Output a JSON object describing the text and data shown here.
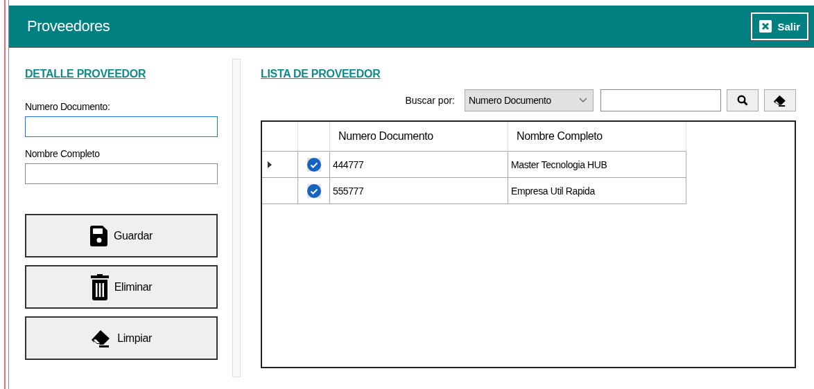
{
  "window": {
    "title": "Proveedores",
    "close_button": "Salir"
  },
  "detail": {
    "heading": "DETALLE PROVEEDOR",
    "fields": [
      {
        "label": "Numero Documento:",
        "focused": true
      },
      {
        "label": "Nombre Completo",
        "focused": false
      }
    ],
    "buttons": [
      {
        "kind": "save",
        "label": "Guardar"
      },
      {
        "kind": "delete",
        "label": "Eliminar"
      },
      {
        "kind": "clear",
        "label": "Limpiar"
      }
    ]
  },
  "list": {
    "heading": "LISTA DE PROVEEDOR",
    "search_label": "Buscar por:",
    "search_by": "Numero Documento",
    "table": {
      "columns": [
        "Numero Documento",
        "Nombre Completo"
      ],
      "rows": [
        {
          "selected": true,
          "checked": true,
          "cells": [
            "444777",
            "Master Tecnologia HUB"
          ]
        },
        {
          "selected": false,
          "checked": true,
          "cells": [
            "555777",
            "Empresa Util Rapida"
          ]
        }
      ]
    }
  }
}
